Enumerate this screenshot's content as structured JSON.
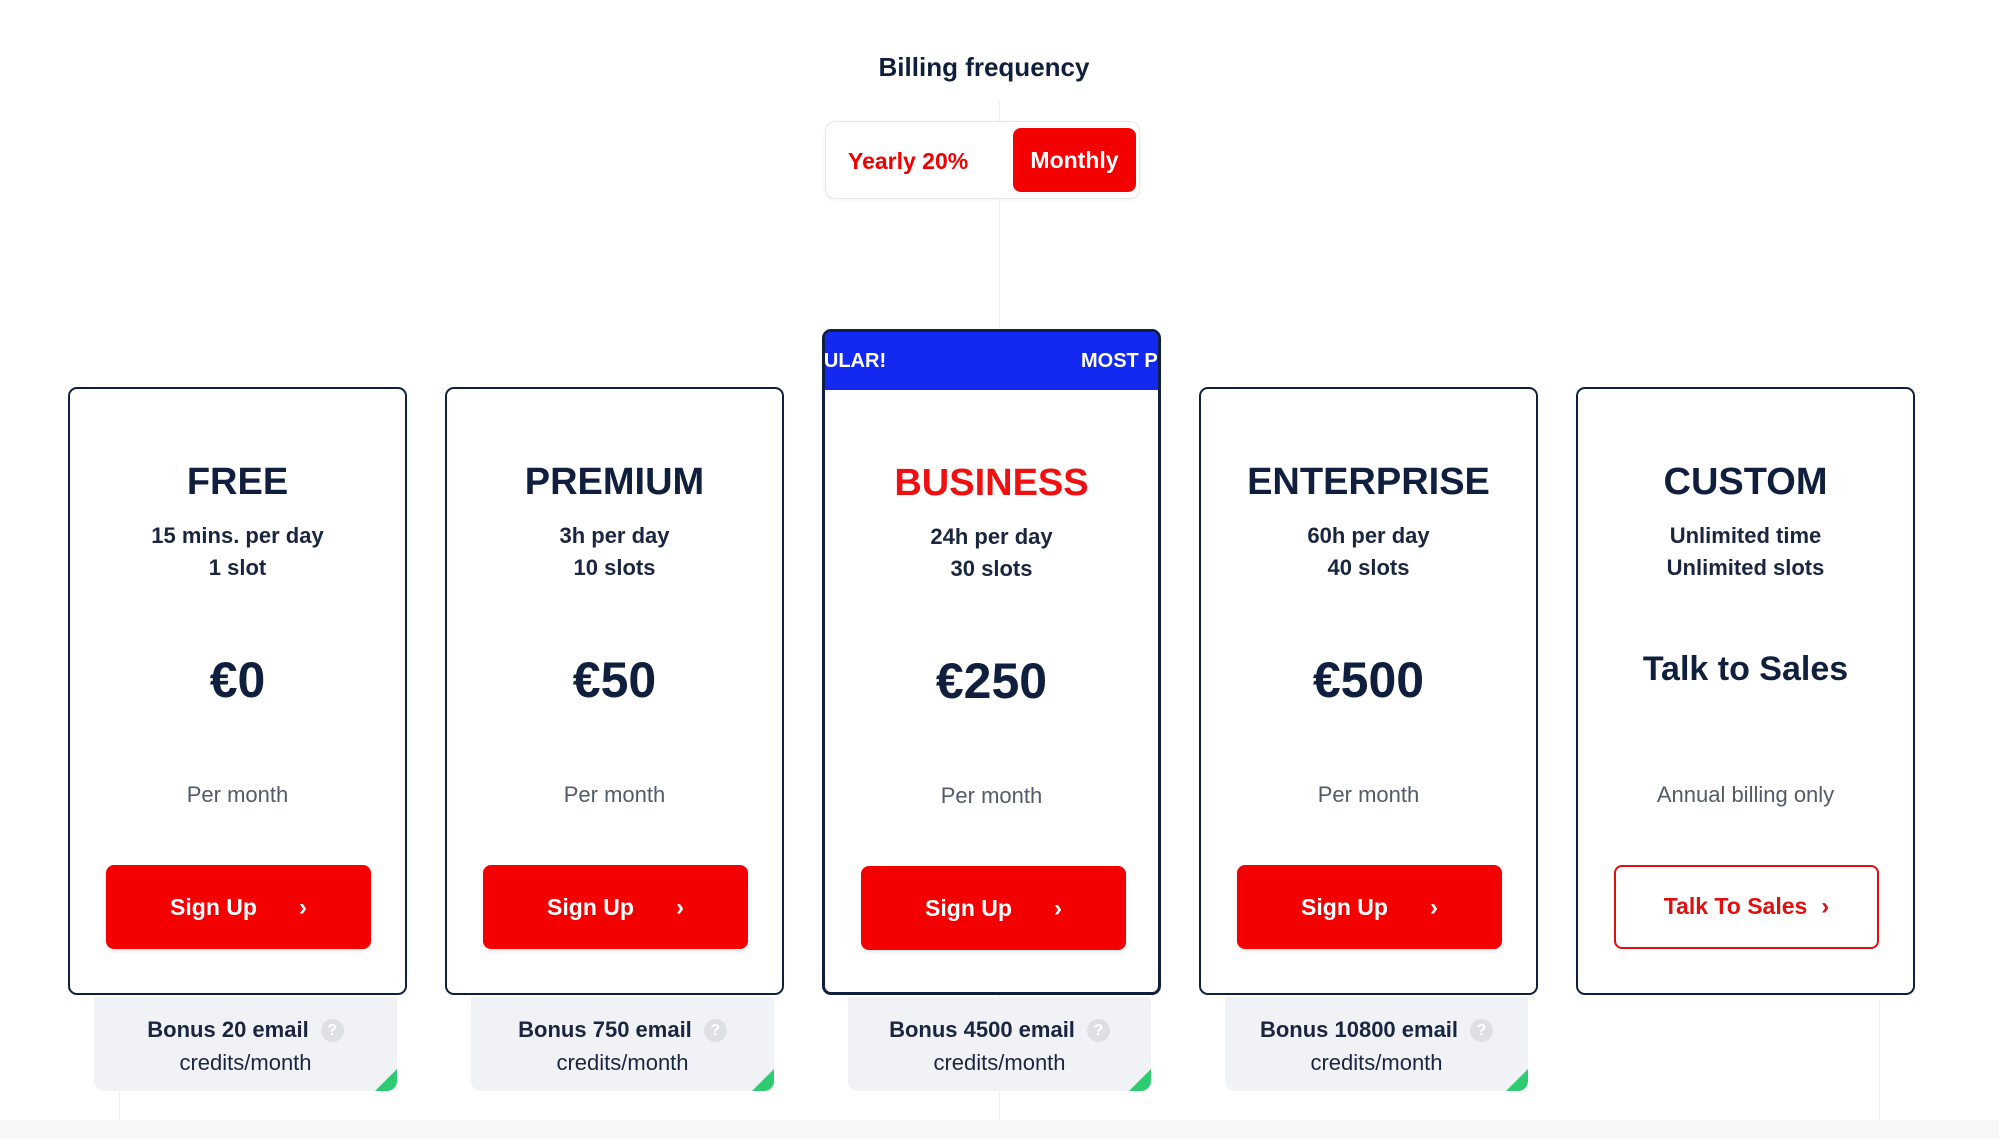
{
  "billing": {
    "title": "Billing frequency",
    "options": [
      "Yearly 20%",
      "Monthly"
    ],
    "selected": "Monthly"
  },
  "colors": {
    "primary_red": "#f50000",
    "navy": "#0f1f3d",
    "ribbon_blue": "#1328f0",
    "bonus_corner_green": "#2ecc71"
  },
  "ribbon": {
    "text_left": "OPULAR!",
    "text_right": "MOST P"
  },
  "plans": [
    {
      "name": "FREE",
      "line1": "15 mins. per day",
      "line2": "1 slot",
      "price": "€0",
      "period": "Per month",
      "cta": "Sign Up",
      "bonus_line1": "Bonus 20 email",
      "bonus_line2": "credits/month"
    },
    {
      "name": "PREMIUM",
      "line1": "3h per day",
      "line2": "10 slots",
      "price": "€50",
      "period": "Per month",
      "cta": "Sign Up",
      "bonus_line1": "Bonus 750 email",
      "bonus_line2": "credits/month"
    },
    {
      "name": "BUSINESS",
      "line1": "24h per day",
      "line2": "30 slots",
      "price": "€250",
      "period": "Per month",
      "cta": "Sign Up",
      "bonus_line1": "Bonus 4500 email",
      "bonus_line2": "credits/month"
    },
    {
      "name": "ENTERPRISE",
      "line1": "60h per day",
      "line2": "40 slots",
      "price": "€500",
      "period": "Per month",
      "cta": "Sign Up",
      "bonus_line1": "Bonus 10800 email",
      "bonus_line2": "credits/month"
    },
    {
      "name": "CUSTOM",
      "line1": "Unlimited time",
      "line2": "Unlimited slots",
      "price": "Talk to Sales",
      "period": "Annual billing only",
      "cta": "Talk To Sales"
    }
  ],
  "icons": {
    "button_chevron": "chevron-right-icon",
    "bonus_help": "question-circle-icon"
  }
}
